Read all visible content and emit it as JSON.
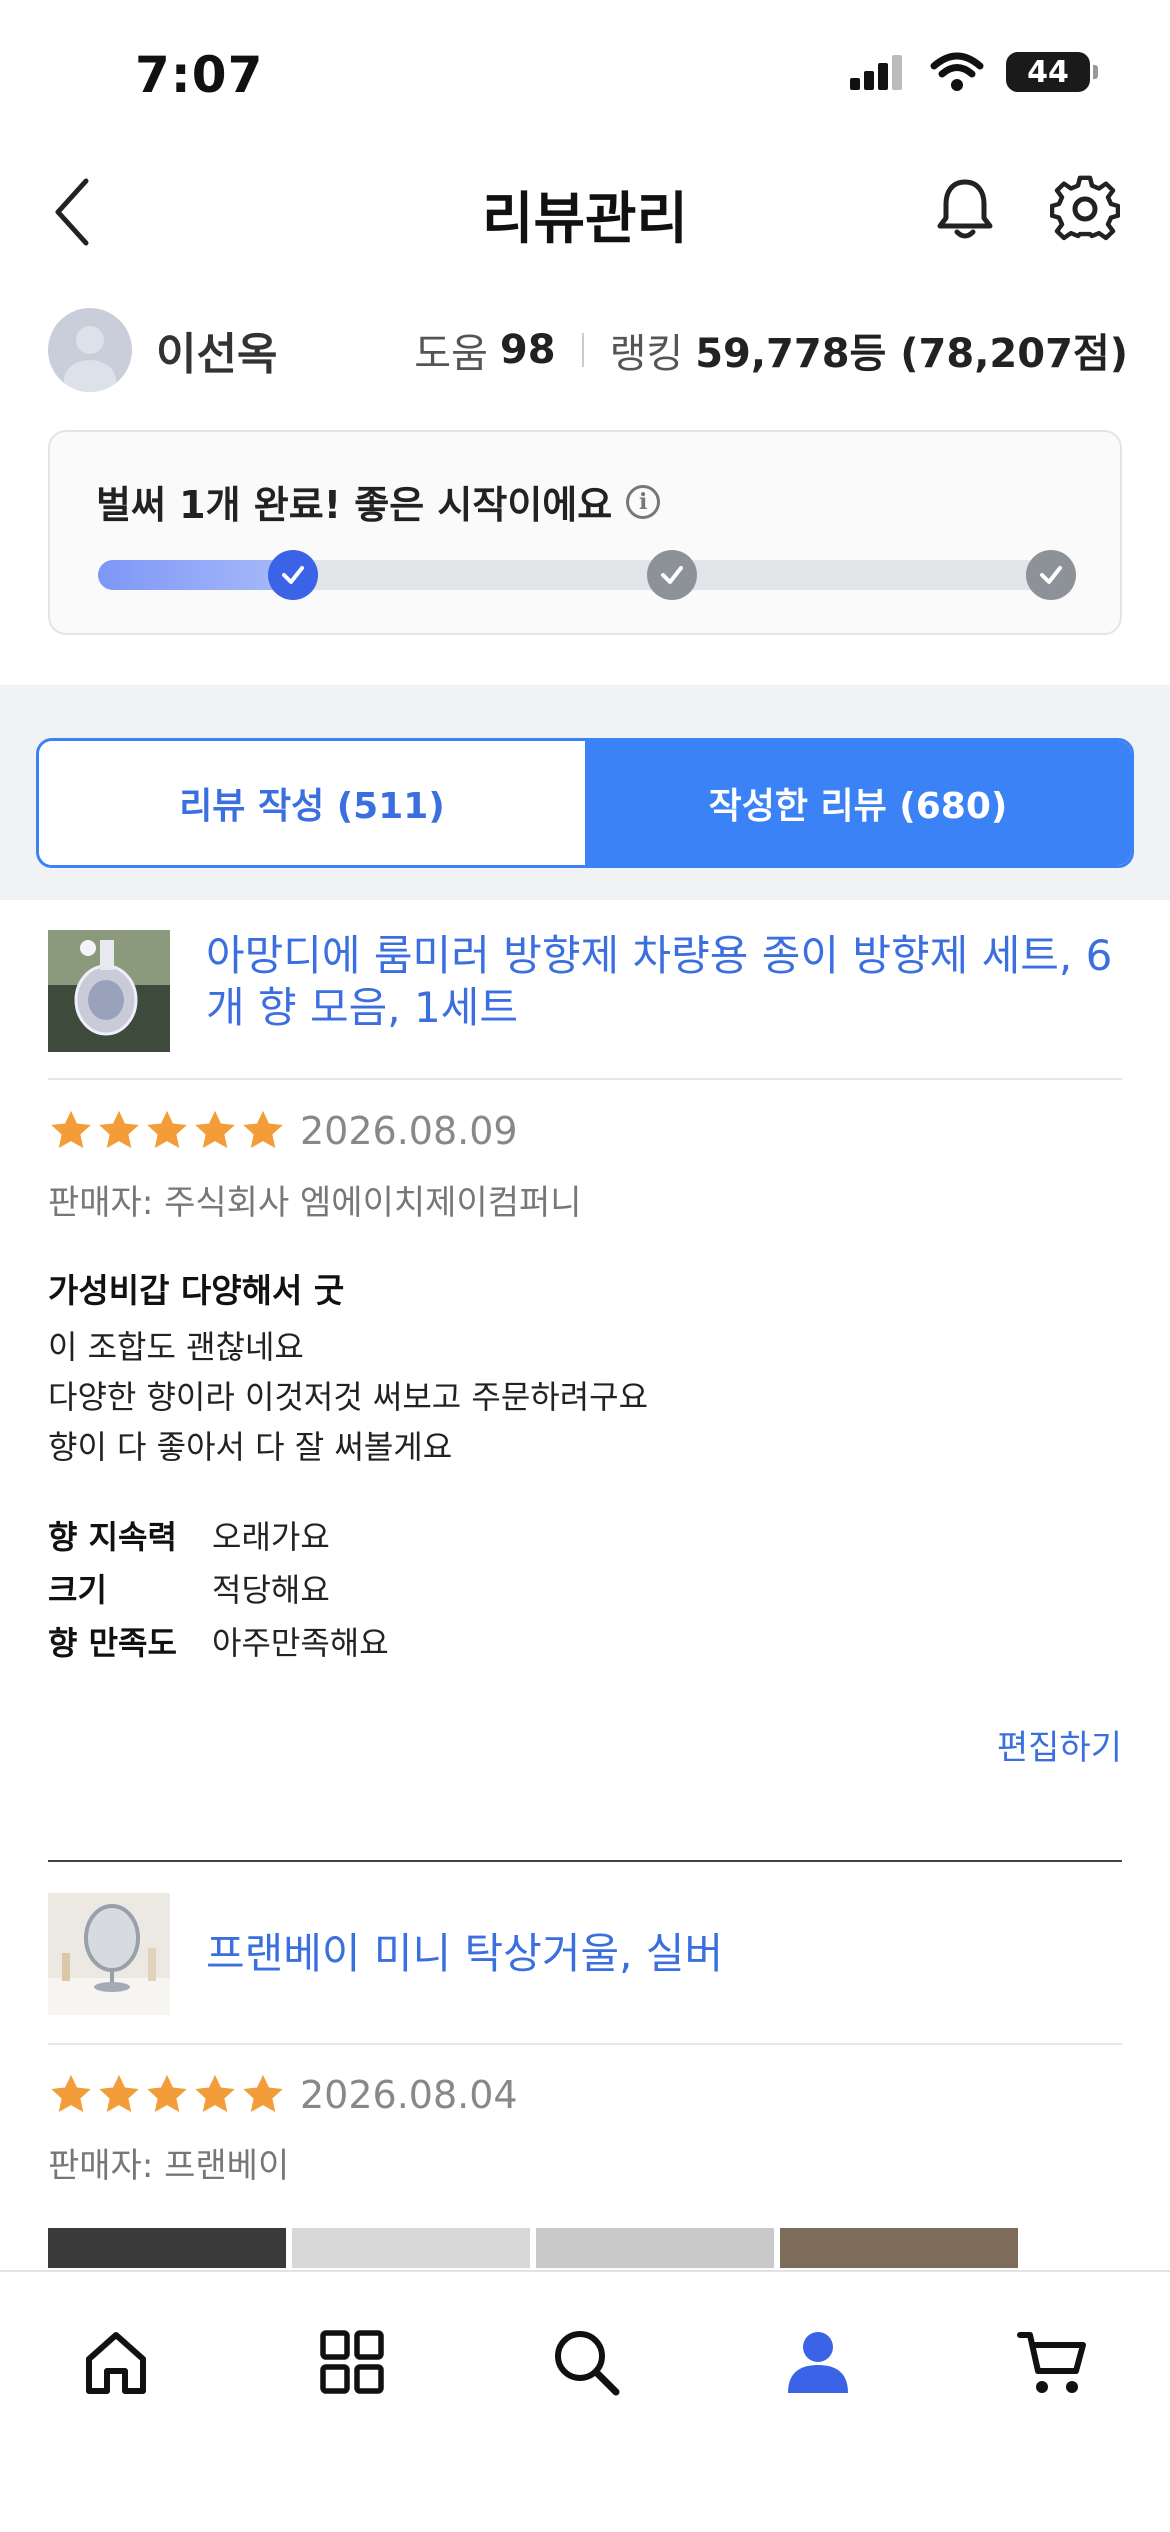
{
  "status_bar": {
    "time": "7:07",
    "battery": "44"
  },
  "header": {
    "title": "리뷰관리"
  },
  "profile": {
    "name": "이선옥",
    "help_label": "도움",
    "help_value": "98",
    "ranking_label": "랭킹",
    "ranking_value": "59,778등 (78,207점)"
  },
  "progress": {
    "message": "벌써 1개 완료! 좋은 시작이에요",
    "completed_steps": 1,
    "total_steps": 3
  },
  "tabs": [
    {
      "label": "리뷰 작성 (511)",
      "active": false
    },
    {
      "label": "작성한 리뷰 (680)",
      "active": true
    }
  ],
  "reviews": [
    {
      "product_title": "아망디에 룸미러 방향제 차량용 종이 방향제 세트, 6개 향 모음, 1세트",
      "rating": 5,
      "date": "2026.08.09",
      "seller": "판매자: 주식회사 엠에이치제이컴퍼니",
      "headline": "가성비갑 다양해서 굿",
      "body_lines": [
        "이 조합도 괜찮네요",
        "다양한 향이라 이것저것 써보고 주문하려구요",
        "향이 다 좋아서 다 잘 써볼게요"
      ],
      "attributes": [
        {
          "key": "향 지속력",
          "value": "오래가요"
        },
        {
          "key": "크기",
          "value": "적당해요"
        },
        {
          "key": "향 만족도",
          "value": "아주만족해요"
        }
      ],
      "edit_label": "편집하기"
    },
    {
      "product_title": "프랜베이 미니 탁상거울, 실버",
      "rating": 5,
      "date": "2026.08.04",
      "seller": "판매자: 프랜베이"
    }
  ],
  "bottom_nav": [
    {
      "name": "home",
      "icon": "home-icon",
      "active": false
    },
    {
      "name": "categories",
      "icon": "grid-icon",
      "active": false
    },
    {
      "name": "search",
      "icon": "search-icon",
      "active": false
    },
    {
      "name": "my",
      "icon": "person-icon",
      "active": true
    },
    {
      "name": "cart",
      "icon": "cart-icon",
      "active": false
    }
  ],
  "colors": {
    "accent": "#3b82f6",
    "link": "#3b6fe0",
    "star": "#f39c3a"
  }
}
